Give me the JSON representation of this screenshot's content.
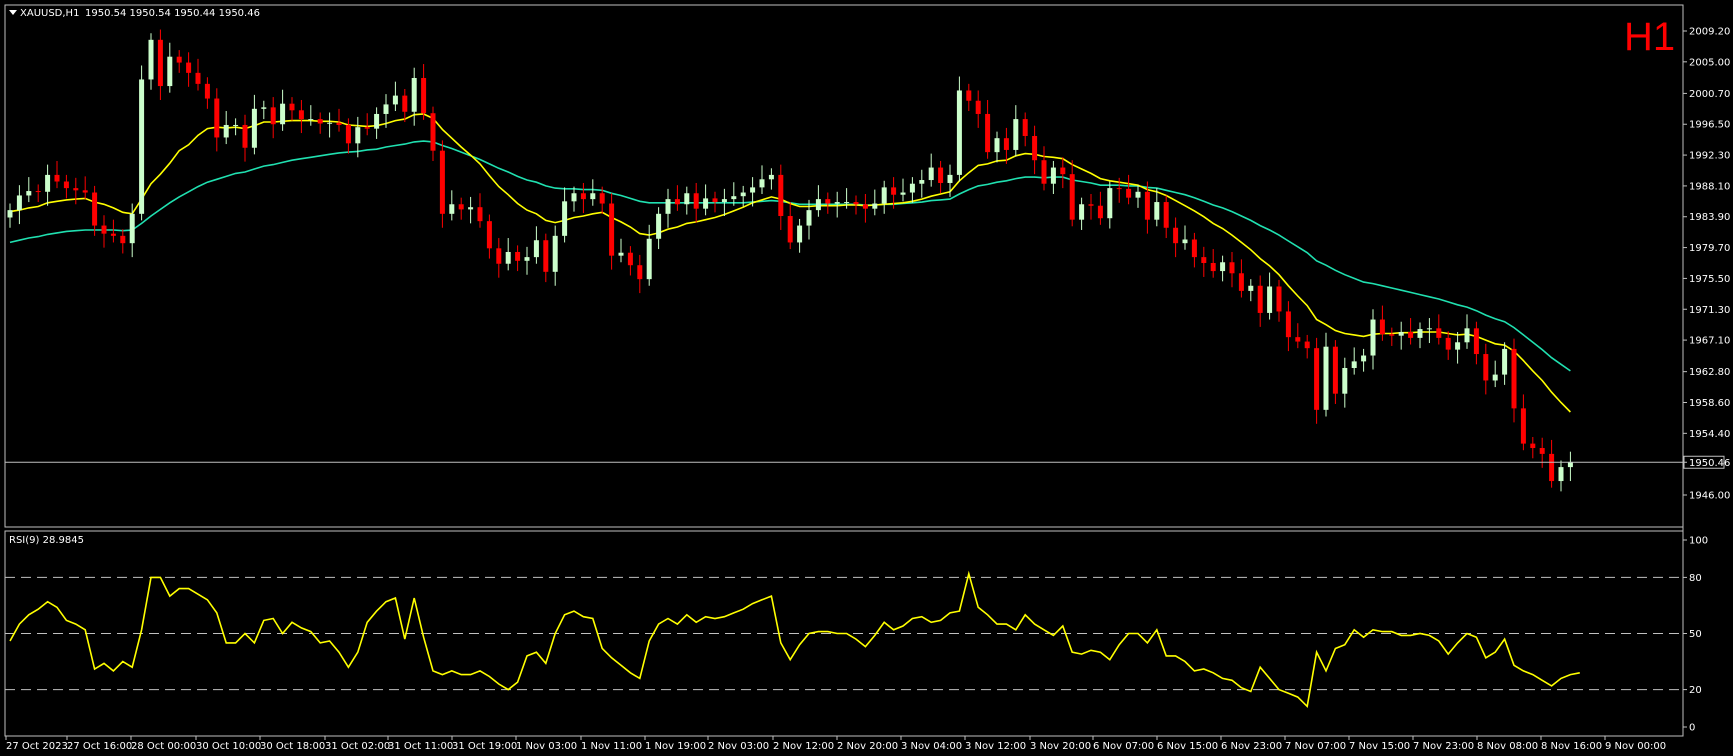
{
  "header": {
    "symbol": "XAUUSD,H1",
    "ohlc": "1950.54 1950.54 1950.44 1950.46",
    "timeframe_badge": "H1"
  },
  "price_axis": {
    "ticks": [
      "2009.20",
      "2005.00",
      "2000.70",
      "1996.50",
      "1992.30",
      "1988.10",
      "1983.90",
      "1979.70",
      "1975.50",
      "1971.30",
      "1967.10",
      "1962.80",
      "1958.60",
      "1954.40",
      "1950.46",
      "1946.00"
    ],
    "current_price": "1950.46"
  },
  "rsi_panel": {
    "label": "RSI(9) 28.9845",
    "ticks": [
      "100",
      "80",
      "50",
      "20",
      "0"
    ]
  },
  "time_axis": {
    "labels": [
      "27 Oct 2023",
      "27 Oct 16:00",
      "28 Oct 00:00",
      "30 Oct 10:00",
      "30 Oct 18:00",
      "31 Oct 02:00",
      "31 Oct 11:00",
      "31 Oct 19:00",
      "1 Nov 03:00",
      "1 Nov 11:00",
      "1 Nov 19:00",
      "2 Nov 03:00",
      "2 Nov 12:00",
      "2 Nov 20:00",
      "3 Nov 04:00",
      "3 Nov 12:00",
      "3 Nov 20:00",
      "6 Nov 07:00",
      "6 Nov 15:00",
      "6 Nov 23:00",
      "7 Nov 07:00",
      "7 Nov 15:00",
      "7 Nov 23:00",
      "8 Nov 08:00",
      "8 Nov 16:00",
      "9 Nov 00:00"
    ]
  },
  "colors": {
    "background": "#000000",
    "bull_candle": "#ccffcc",
    "bear_candle": "#ff0000",
    "fast_ma": "#ffff00",
    "slow_ma": "#20e0b0",
    "rsi_line": "#ffff00",
    "badge": "#ff0000",
    "grid_dash": "#c0c0c0"
  },
  "chart_data": [
    {
      "type": "candlestick",
      "title": "XAUUSD,H1",
      "ylim": [
        1946.0,
        2010.5
      ],
      "series": [
        {
          "name": "XAUUSD",
          "close": [
            1984.8,
            1986.8,
            1987.4,
            1987.3,
            1989.6,
            1988.7,
            1987.8,
            1987.5,
            1987.2,
            1982.7,
            1981.6,
            1981.3,
            1980.3,
            1984.3,
            2002.6,
            2008.0,
            2001.7,
            2005.7,
            2004.9,
            2003.5,
            2002.0,
            2000.0,
            1994.7,
            1996.4,
            1996.4,
            1993.3,
            1998.6,
            1998.8,
            1996.5,
            1999.3,
            1998.4,
            1997.2,
            1997.2,
            1996.6,
            1996.7,
            1996.4,
            1993.9,
            1996.1,
            1995.9,
            1997.9,
            1999.2,
            2000.4,
            1998.2,
            2002.8,
            1998.0,
            1992.9,
            1984.3,
            1985.6,
            1984.9,
            1985.2,
            1983.3,
            1979.6,
            1977.5,
            1979.1,
            1977.9,
            1978.4,
            1980.7,
            1976.4,
            1981.3,
            1986.0,
            1987.1,
            1986.3,
            1987.1,
            1985.7,
            1978.6,
            1979.0,
            1977.3,
            1975.4,
            1980.9,
            1984.3,
            1986.3,
            1985.6,
            1987.1,
            1985.0,
            1986.4,
            1985.9,
            1986.3,
            1986.7,
            1987.2,
            1987.9,
            1989.0,
            1989.6,
            1984.0,
            1980.4,
            1982.7,
            1984.8,
            1986.3,
            1985.7,
            1985.9,
            1985.9,
            1985.6,
            1985.0,
            1985.7,
            1987.9,
            1986.9,
            1987.2,
            1988.4,
            1988.9,
            1990.6,
            1988.5,
            1989.6,
            2001.1,
            1999.7,
            1997.9,
            1992.7,
            1994.6,
            1993.0,
            1997.2,
            1994.9,
            1991.6,
            1988.4,
            1990.6,
            1989.7,
            1983.5,
            1985.6,
            1985.4,
            1983.7,
            1987.8,
            1987.7,
            1986.5,
            1987.3,
            1983.5,
            1985.9,
            1982.4,
            1980.3,
            1980.8,
            1978.4,
            1977.6,
            1976.5,
            1977.7,
            1976.2,
            1973.8,
            1974.5,
            1970.8,
            1974.4,
            1971.0,
            1967.5,
            1966.9,
            1966.0,
            1957.6,
            1966.2,
            1959.8,
            1963.3,
            1964.2,
            1965.0,
            1969.9,
            1967.9,
            1967.7,
            1968.2,
            1967.4,
            1968.6,
            1968.7,
            1967.4,
            1965.8,
            1966.8,
            1968.7,
            1965.2,
            1961.6,
            1962.4,
            1965.9,
            1957.8,
            1953.0,
            1952.4,
            1951.6,
            1947.9,
            1949.8,
            1950.5
          ]
        }
      ]
    },
    {
      "type": "line",
      "series": [
        {
          "name": "",
          "values": [
            1984.6,
            1984.8,
            1985.1,
            1985.3,
            1985.8,
            1986.0,
            1986.2,
            1986.3,
            1986.4,
            1985.9,
            1985.6,
            1985.1,
            1984.5,
            1984.3,
            1986.3,
            1988.4,
            1989.7,
            1991.2,
            1992.9,
            1993.7,
            1995.0,
            1995.9,
            1996.1,
            1996.0,
            1996.1,
            1995.9,
            1996.3,
            1996.8,
            1996.8,
            1996.9,
            1997.0,
            1997.0,
            1997.0,
            1996.9,
            1996.9,
            1996.8,
            1996.4,
            1996.3,
            1996.2,
            1996.3,
            1996.6,
            1997.0,
            1997.2,
            1997.8,
            1997.9,
            1997.3,
            1995.8,
            1994.6,
            1993.4,
            1992.3,
            1991.1,
            1989.5,
            1988.0,
            1986.9,
            1985.7,
            1984.8,
            1984.3,
            1983.4,
            1983.1,
            1983.4,
            1983.8,
            1984.0,
            1984.3,
            1984.5,
            1983.8,
            1983.2,
            1982.5,
            1981.6,
            1981.4,
            1981.7,
            1982.2,
            1982.5,
            1983.0,
            1983.2,
            1983.5,
            1983.8,
            1984.2,
            1984.7,
            1985.2,
            1985.8,
            1986.2,
            1986.6,
            1986.3,
            1985.7,
            1985.3,
            1985.3,
            1985.4,
            1985.4,
            1985.4,
            1985.5,
            1985.5,
            1985.4,
            1985.5,
            1985.6,
            1985.7,
            1985.8,
            1986.0,
            1986.3,
            1986.7,
            1987.0,
            1987.3,
            1988.8,
            1989.9,
            1990.9,
            1991.1,
            1991.5,
            1991.6,
            1992.2,
            1992.5,
            1992.4,
            1992.1,
            1992.0,
            1991.8,
            1991.0,
            1990.4,
            1989.8,
            1989.1,
            1988.8,
            1988.6,
            1988.4,
            1988.2,
            1987.6,
            1987.3,
            1986.8,
            1986.1,
            1985.4,
            1984.7,
            1983.9,
            1983.0,
            1982.3,
            1981.4,
            1980.4,
            1979.4,
            1978.2,
            1977.2,
            1976.0,
            1974.5,
            1973.1,
            1971.8,
            1969.9,
            1969.2,
            1968.4,
            1968.0,
            1967.8,
            1967.6,
            1967.9,
            1968.0,
            1968.0,
            1968.1,
            1968.1,
            1968.2,
            1968.2,
            1968.2,
            1968.0,
            1967.8,
            1967.9,
            1967.6,
            1967.1,
            1966.6,
            1966.4,
            1965.6,
            1964.3,
            1962.9,
            1961.6,
            1960.0,
            1958.6,
            1957.3
          ]
        },
        {
          "name": "",
          "values": [
            1980.4,
            1980.7,
            1981.0,
            1981.2,
            1981.5,
            1981.7,
            1981.9,
            1982.0,
            1982.1,
            1982.1,
            1982.1,
            1982.1,
            1982.0,
            1982.1,
            1983.0,
            1984.0,
            1984.9,
            1985.8,
            1986.6,
            1987.3,
            1988.0,
            1988.6,
            1989.0,
            1989.4,
            1989.8,
            1990.0,
            1990.4,
            1990.8,
            1991.0,
            1991.3,
            1991.6,
            1991.8,
            1992.0,
            1992.2,
            1992.4,
            1992.6,
            1992.7,
            1992.8,
            1993.0,
            1993.1,
            1993.4,
            1993.6,
            1993.8,
            1994.1,
            1994.2,
            1994.1,
            1993.6,
            1993.2,
            1992.7,
            1992.2,
            1991.7,
            1991.1,
            1990.5,
            1990.0,
            1989.4,
            1988.9,
            1988.6,
            1988.1,
            1987.8,
            1987.7,
            1987.7,
            1987.6,
            1987.6,
            1987.5,
            1987.1,
            1986.8,
            1986.4,
            1986.0,
            1985.8,
            1985.8,
            1985.8,
            1985.8,
            1985.8,
            1985.8,
            1985.8,
            1985.8,
            1985.8,
            1985.8,
            1985.8,
            1985.9,
            1986.0,
            1986.1,
            1986.0,
            1985.8,
            1985.6,
            1985.6,
            1985.6,
            1985.6,
            1985.6,
            1985.6,
            1985.6,
            1985.5,
            1985.5,
            1985.6,
            1985.6,
            1985.7,
            1985.8,
            1985.9,
            1986.1,
            1986.2,
            1986.3,
            1987.0,
            1987.6,
            1988.1,
            1988.3,
            1988.6,
            1988.8,
            1989.1,
            1989.3,
            1989.3,
            1989.2,
            1989.3,
            1989.3,
            1988.9,
            1988.7,
            1988.5,
            1988.2,
            1988.2,
            1988.2,
            1988.1,
            1988.1,
            1987.9,
            1987.8,
            1987.5,
            1987.2,
            1986.9,
            1986.5,
            1986.0,
            1985.5,
            1985.1,
            1984.6,
            1984.0,
            1983.4,
            1982.7,
            1982.1,
            1981.4,
            1980.6,
            1979.8,
            1979.0,
            1977.9,
            1977.3,
            1976.6,
            1976.0,
            1975.5,
            1975.0,
            1974.8,
            1974.5,
            1974.2,
            1973.9,
            1973.6,
            1973.3,
            1973.0,
            1972.7,
            1972.3,
            1971.9,
            1971.6,
            1971.1,
            1970.5,
            1970.0,
            1969.6,
            1968.8,
            1967.8,
            1966.8,
            1965.8,
            1964.7,
            1963.8,
            1962.9
          ]
        }
      ]
    },
    {
      "type": "line",
      "title": "RSI(9) 28.9845",
      "ylim": [
        0,
        100
      ],
      "levels": [
        80,
        50,
        20
      ],
      "series": [
        {
          "name": "RSI(9)",
          "values": [
            46,
            55,
            60,
            63,
            67,
            64,
            57,
            55,
            52,
            31,
            34,
            30,
            35,
            32,
            52,
            80,
            80,
            70,
            74,
            74,
            71,
            68,
            61,
            45,
            45,
            50,
            45,
            57,
            58,
            50,
            56,
            53,
            51,
            45,
            46,
            40,
            32,
            40,
            56,
            62,
            67,
            69,
            47,
            69,
            48,
            30,
            28,
            30,
            28,
            28,
            30,
            27,
            23,
            20,
            24,
            38,
            40,
            34,
            50,
            60,
            62,
            59,
            58,
            42,
            37,
            33,
            29,
            26,
            46,
            55,
            58,
            55,
            60,
            56,
            59,
            58,
            59,
            61,
            63,
            66,
            68,
            70,
            45,
            36,
            44,
            50,
            51,
            51,
            50,
            50,
            47,
            43,
            49,
            56,
            52,
            54,
            58,
            59,
            56,
            57,
            61,
            62,
            82,
            64,
            60,
            55,
            55,
            52,
            60,
            55,
            52,
            49,
            54,
            40,
            39,
            41,
            40,
            36,
            44,
            50,
            50,
            45,
            52,
            38,
            38,
            35,
            30,
            31,
            29,
            26,
            25,
            21,
            19,
            32,
            26,
            20,
            18,
            16,
            11,
            40,
            30,
            42,
            44,
            52,
            48,
            52,
            51,
            51,
            49,
            49,
            50,
            49,
            46,
            39,
            45,
            50,
            48,
            37,
            40,
            47,
            33,
            30,
            28,
            25,
            22,
            26,
            28,
            29
          ]
        }
      ]
    }
  ]
}
